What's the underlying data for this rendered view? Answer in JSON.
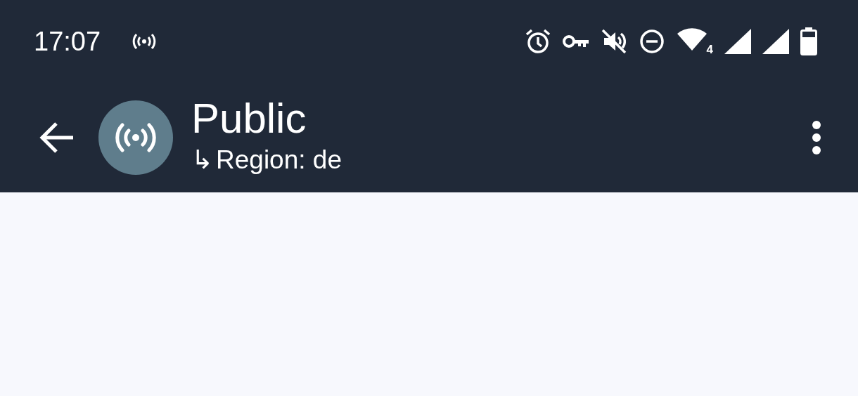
{
  "status_bar": {
    "time": "17:07",
    "wifi_label": "4"
  },
  "toolbar": {
    "title": "Public",
    "subtitle_icon": "↳",
    "subtitle": "Region: de"
  }
}
